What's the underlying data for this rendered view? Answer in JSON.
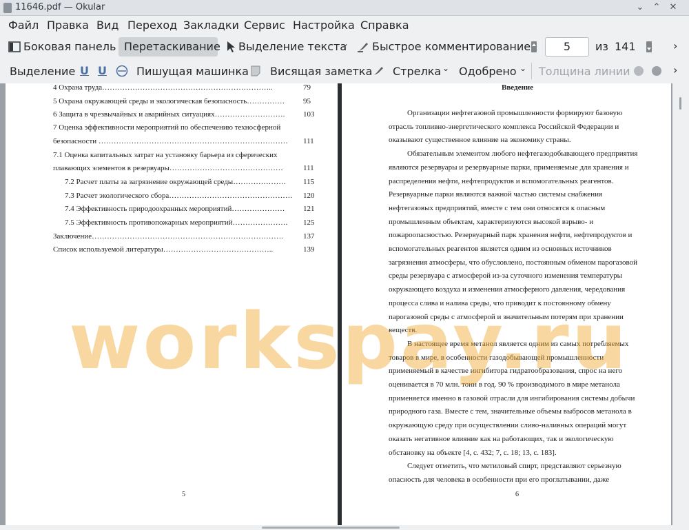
{
  "window": {
    "title": "11646.pdf  — Okular"
  },
  "menu": [
    "Файл",
    "Правка",
    "Вид",
    "Переход",
    "Закладки",
    "Сервис",
    "Настройка",
    "Справка"
  ],
  "toolbar1": {
    "sidebar": "Боковая панель",
    "drag": "Перетаскивание",
    "text_select": "Выделение текста",
    "quick_annot": "Быстрое комментирование",
    "page_current": "5",
    "page_of": "из",
    "page_total": "141"
  },
  "toolbar2": {
    "selection": "Выделение",
    "u1": "U",
    "u2": "U",
    "typewriter": "Пишущая машинка",
    "sticky": "Висящая заметка",
    "arrow": "Стрелка",
    "approved": "Одобрено",
    "line_width": "Толщина линии"
  },
  "left_page": {
    "toc": [
      {
        "text": "4 Охрана труда…………………………………………………………..",
        "num": "79",
        "indent": false
      },
      {
        "text": "5 Охрана окружающей среды и экологическая безопасность……………",
        "num": "95",
        "indent": false
      },
      {
        "text": "6 Защита в чрезвычайных и аварийных ситуациях……………………….",
        "num": "103",
        "indent": false
      },
      {
        "text": "7 Оценка эффективности мероприятий по обеспечению техносферной",
        "num": "",
        "indent": false
      },
      {
        "text": "безопасности …………………………………………………………………",
        "num": "111",
        "indent": false
      },
      {
        "text": "7.1 Оценка капитальных затрат на установку барьера из сферических",
        "num": "",
        "indent": false
      },
      {
        "text": "плавающих элементов в резервуары………………………………………",
        "num": "111",
        "indent": false
      },
      {
        "text": "7.2 Расчет платы за загрязнение окружающей среды…………………",
        "num": "115",
        "indent": true
      },
      {
        "text": "7.3 Расчет экологического сбора………………………………………….",
        "num": "120",
        "indent": true
      },
      {
        "text": "7.4  Эффективность природоохранных мероприятий…………………",
        "num": "121",
        "indent": true
      },
      {
        "text": "7.5  Эффективность противопожарных мероприятий………………….",
        "num": "125",
        "indent": true
      },
      {
        "text": "Заключение………………………………………………………………….",
        "num": "137",
        "indent": false
      },
      {
        "text": "Список используемой литературы……………………………………..",
        "num": "139",
        "indent": false
      }
    ],
    "page_number": "5"
  },
  "right_page": {
    "heading": "Введение",
    "lines": [
      "Организации нефтегазовой промышленности формируют базовую",
      "отрасль топливно-энергетического комплекса Российской Федерации и",
      "оказывают существенное влияние на экономику страны.",
      "Обязательным элементом любого нефтегазодобывающего предприятия",
      "являются резервуары и резервуарные парки, применяемые для хранения и",
      "распределения нефти, нефтепродуктов и вспомогательных реагентов.",
      "Резервуарные парки являются важной частью системы снабжения",
      "нефтегазовых предприятий, вместе с тем они относятся к опасным",
      "промышленным объектам, характеризуются высокой взрыво- и",
      "пожароопасностью. Резервуарный парк хранения нефти, нефтепродуктов и",
      "вспомогательных реагентов является одним из основных источников",
      "загрязнения атмосферы, что обусловлено, постоянным обменом парогазовой",
      "среды резервуара с атмосферой из-за суточного изменения температуры",
      "окружающего воздуха и изменения атмосферного давления, чередования",
      "процесса слива и налива среды, что приводит к постоянному обмену",
      "парогазовой среды с атмосферой и значительным потерям при хранении",
      "веществ.",
      "В настоящее время метанол является одним из самых потребляемых",
      "товаров в мире, в особенности газодобывающей промышленности",
      "применяемый в качестве ингибитора гидратообразования, спрос на него",
      "оценивается в 70 млн. тонн в год. 90 % производимого в мире метанола",
      "применяется именно в газовой отрасли для ингибирования системы добычи",
      "природного газа. Вместе с тем, значительные объемы выбросов метанола в",
      "окружающую среду при осуществлении сливо-наливных операций могут",
      "оказать негативное влияние как на работающих, так и экологическую",
      "обстановку на объекте [4, с. 432; 7, с. 18; 13, с. 183].",
      "Следует отметить, что метиловый спирт, представляют серьезную",
      "опасность для человека в особенности при его проглатывании, даже"
    ],
    "page_number": "6"
  },
  "watermark": "workspay.ru"
}
